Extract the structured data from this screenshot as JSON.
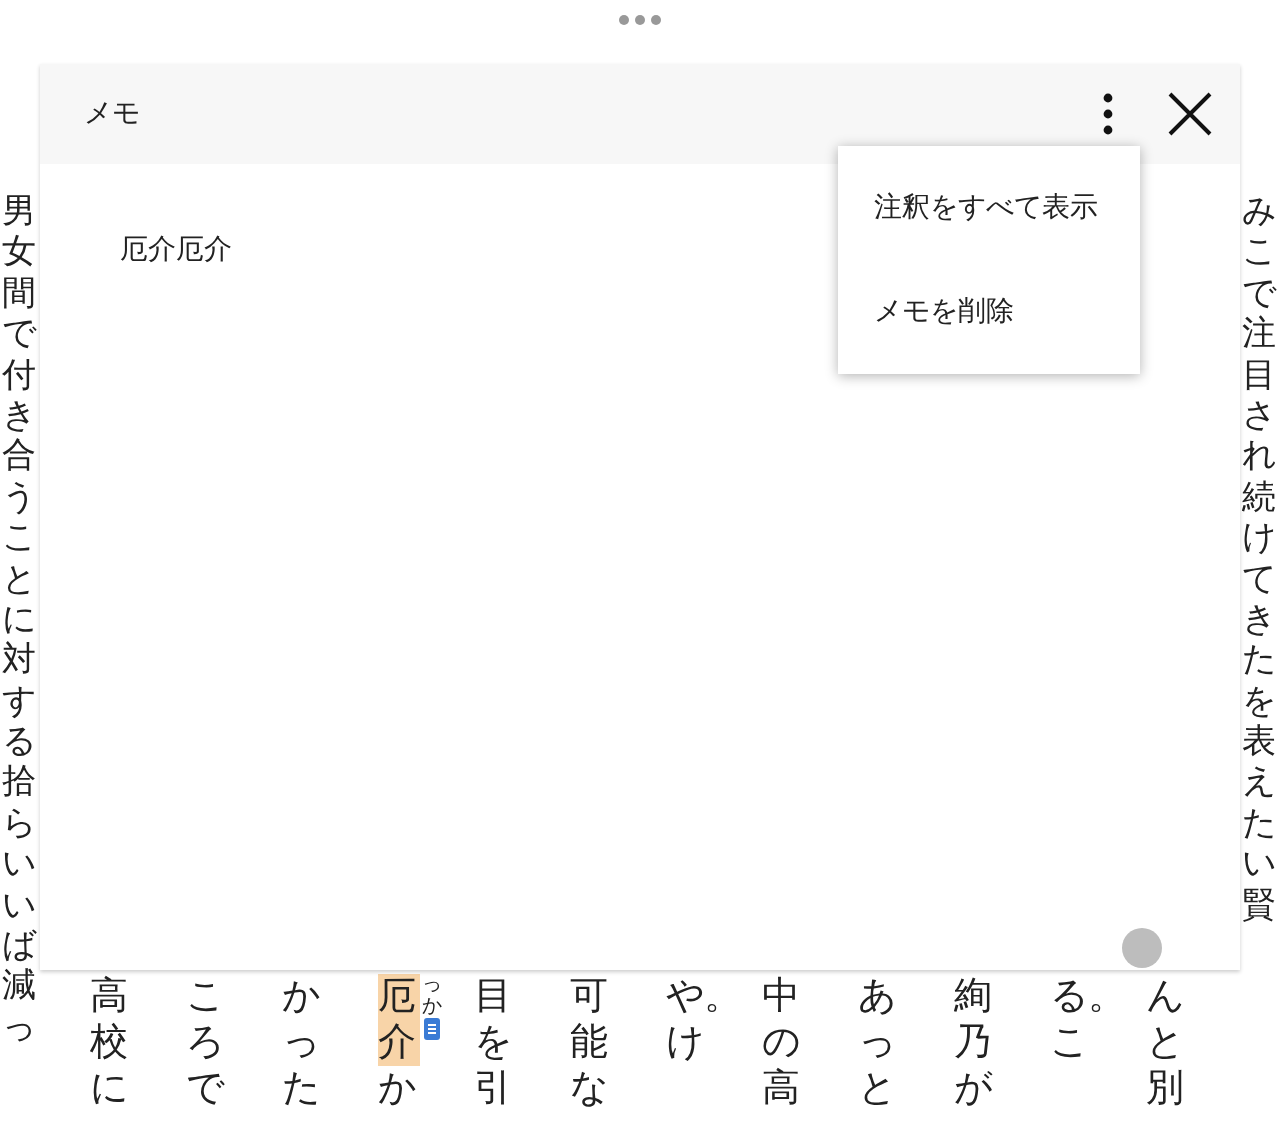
{
  "reader": {
    "left_column": "男女間で付き合うことに対する拾らいいば減っ",
    "columns": [
      {
        "text": "高校に"
      },
      {
        "text": "ころで"
      },
      {
        "text": "かった"
      },
      {
        "text": "か",
        "highlight": {
          "text": "厄介",
          "ruby": "っか",
          "has_memo": true
        }
      },
      {
        "text": "目を引"
      },
      {
        "text": "可能な"
      },
      {
        "text": "や。け"
      },
      {
        "text": "中の高"
      },
      {
        "text": "あっと"
      },
      {
        "text": "絢乃が"
      },
      {
        "text": "る。こ"
      },
      {
        "text": "んと別"
      }
    ],
    "right_column": "みこで注目され続けてきたを表えたい賢"
  },
  "memo_dialog": {
    "title": "メモ",
    "body": "厄介厄介",
    "menu": {
      "items": [
        "注釈をすべて表示",
        "メモを削除"
      ]
    }
  }
}
